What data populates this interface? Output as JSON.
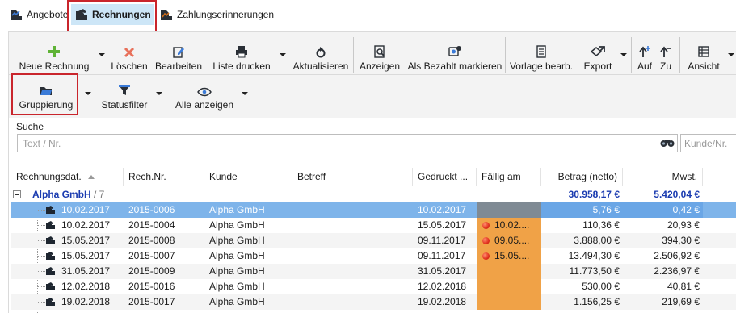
{
  "tabs": [
    {
      "label": "Angebote"
    },
    {
      "label": "Rechnungen"
    },
    {
      "label": "Zahlungserinnerungen"
    }
  ],
  "ribbon": {
    "new_invoice": "Neue Rechnung",
    "delete": "Löschen",
    "edit": "Bearbeiten",
    "print_list": "Liste drucken",
    "refresh": "Aktualisieren",
    "show": "Anzeigen",
    "mark_paid": "Als Bezahlt markieren",
    "edit_template": "Vorlage bearb.",
    "export": "Export",
    "up": "Auf",
    "down": "Zu",
    "view": "Ansicht",
    "grouping": "Gruppierung",
    "status_filter": "Statusfilter",
    "show_all": "Alle anzeigen"
  },
  "search": {
    "label": "Suche",
    "placeholder": "Text / Nr.",
    "customer_placeholder": "Kunde/Nr."
  },
  "grid": {
    "columns": [
      "Rechnungsdat.",
      "Rech.Nr.",
      "Kunde",
      "Betreff",
      "Gedruckt ...",
      "Fällig am",
      "Betrag (netto)",
      "Mwst."
    ],
    "group": {
      "name": "Alpha GmbH",
      "count": "/ 7",
      "sum_netto": "30.958,17 €",
      "sum_mwst": "5.420,04 €"
    },
    "rows": [
      {
        "date": "10.02.2017",
        "nr": "2015-0006",
        "customer": "Alpha GmbH",
        "subject": "",
        "printed": "10.02.2017",
        "due": "",
        "amount": "5,76 €",
        "vat": "0,42 €"
      },
      {
        "date": "10.02.2017",
        "nr": "2015-0004",
        "customer": "Alpha GmbH",
        "subject": "",
        "printed": "15.05.2017",
        "due": "10.02....",
        "amount": "110,36 €",
        "vat": "20,93 €"
      },
      {
        "date": "15.05.2017",
        "nr": "2015-0008",
        "customer": "Alpha GmbH",
        "subject": "",
        "printed": "09.11.2017",
        "due": "09.05....",
        "amount": "3.888,00 €",
        "vat": "394,30 €"
      },
      {
        "date": "15.05.2017",
        "nr": "2015-0007",
        "customer": "Alpha GmbH",
        "subject": "",
        "printed": "09.11.2017",
        "due": "15.05....",
        "amount": "13.494,30 €",
        "vat": "2.506,92 €"
      },
      {
        "date": "31.05.2017",
        "nr": "2015-0009",
        "customer": "Alpha GmbH",
        "subject": "",
        "printed": "31.05.2017",
        "due": "",
        "amount": "11.773,50 €",
        "vat": "2.236,97 €"
      },
      {
        "date": "12.02.2018",
        "nr": "2015-0016",
        "customer": "Alpha GmbH",
        "subject": "",
        "printed": "12.02.2018",
        "due": "",
        "amount": "530,00 €",
        "vat": "40,81 €"
      },
      {
        "date": "19.02.2018",
        "nr": "2015-0017",
        "customer": "Alpha GmbH",
        "subject": "",
        "printed": "19.02.2018",
        "due": "",
        "amount": "1.156,25 €",
        "vat": "219,69 €"
      }
    ]
  },
  "colors": {
    "accent": "#1a3bb0",
    "selected_row": "#7eb4ea",
    "overdue": "#f0a247",
    "highlight_box": "#c9252c"
  }
}
